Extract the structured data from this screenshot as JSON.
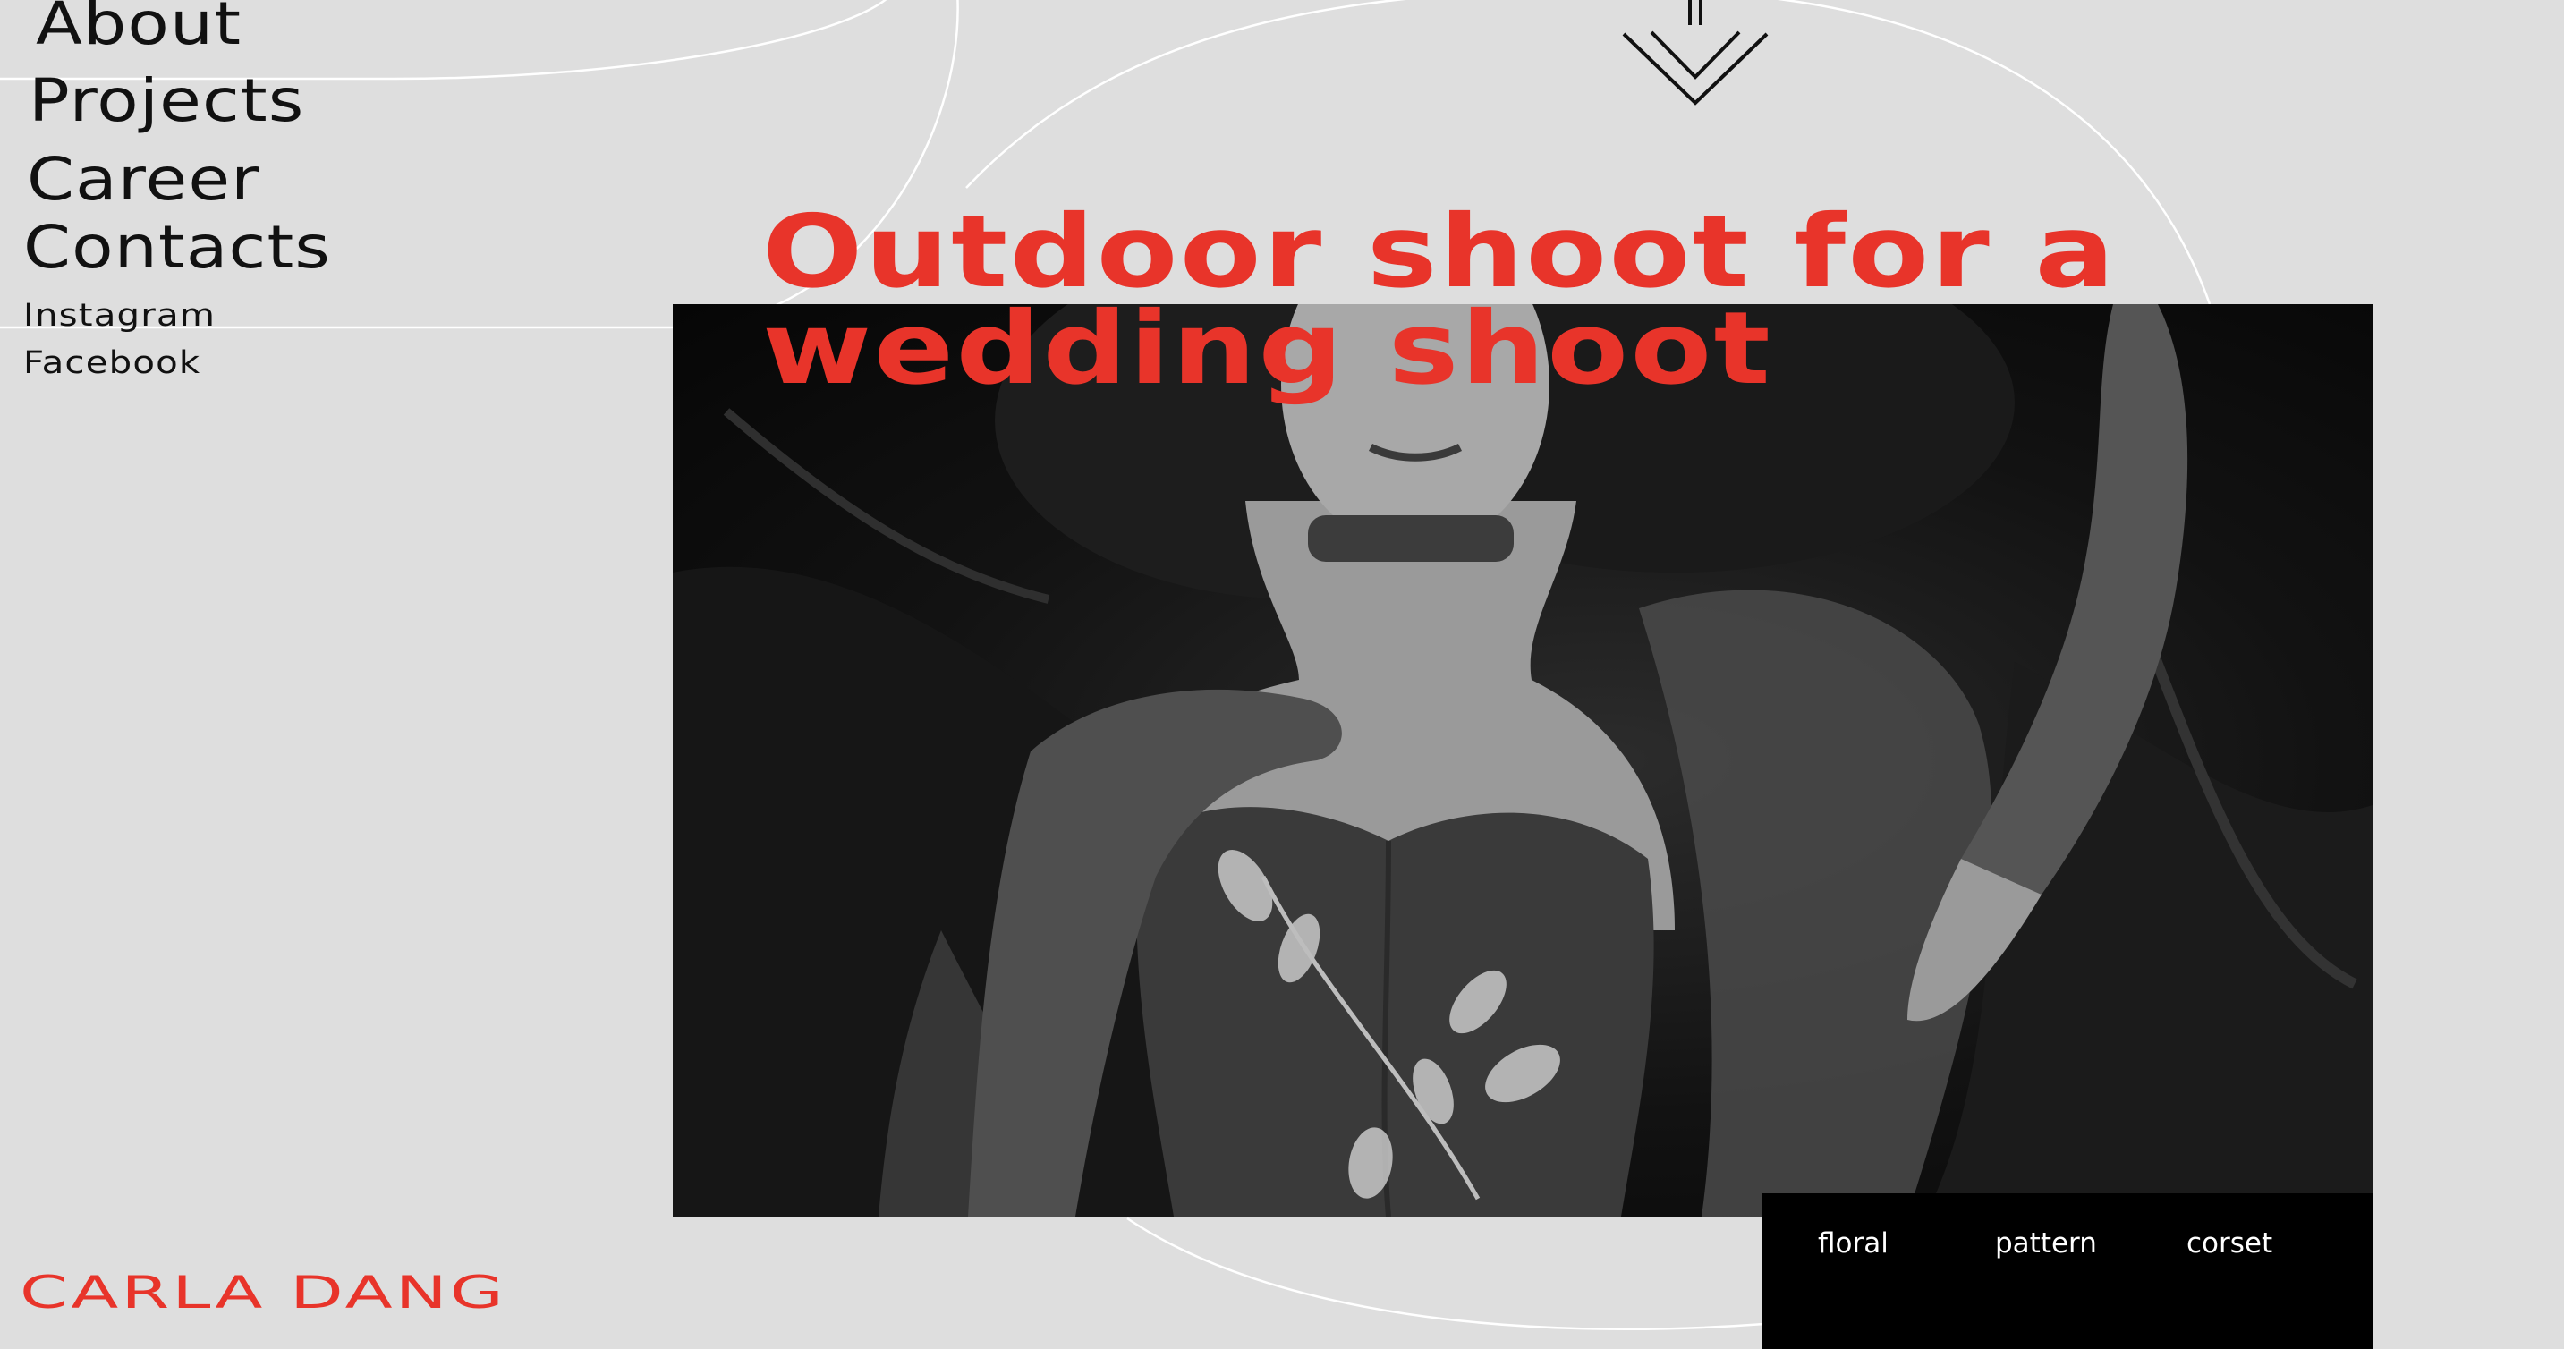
{
  "nav": {
    "main": [
      "About",
      "Projects",
      "Career",
      "Contacts"
    ],
    "social": [
      "Instagram",
      "Facebook"
    ]
  },
  "headline": {
    "line1": "Outdoor shoot for a",
    "line2": "wedding shoot"
  },
  "tags": [
    "floral",
    "pattern",
    "corset"
  ],
  "logo": "CARLA DANG",
  "icons": {
    "scroll": "double-chevron-down-icon"
  },
  "colors": {
    "background": "#dedede",
    "accent": "#e8342a",
    "text": "#111111",
    "tag_bar": "#000000",
    "tag_text": "#ffffff"
  }
}
